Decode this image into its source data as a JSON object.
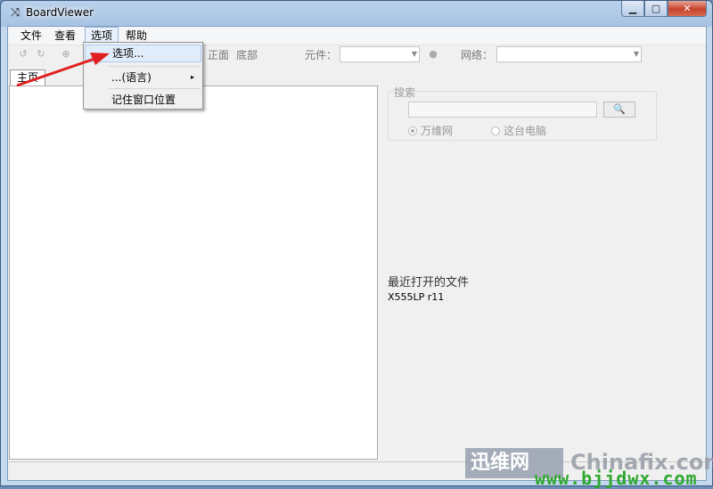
{
  "window": {
    "title": "BoardViewer",
    "app_icon": "⤨",
    "minimize": "▁",
    "maximize": "▢",
    "close": "✕"
  },
  "menu": {
    "file": "文件",
    "view": "查看",
    "options": "选项",
    "help": "帮助"
  },
  "toolbar": {
    "front": "正面",
    "bottom": "底部",
    "component_label": "元件：",
    "net_label": "网络："
  },
  "tabs": {
    "home": "主页"
  },
  "dropdown": {
    "options": "选项...",
    "language": "...(语言)",
    "remember_position": "记住窗口位置",
    "submenu_arrow": "▸"
  },
  "search": {
    "label": "搜索",
    "button_icon": "🔍",
    "option_web": "万维网",
    "option_local": "这台电脑"
  },
  "recent": {
    "title": "最近打开的文件",
    "file": "X555LP r11"
  },
  "watermark": {
    "brand": "迅维网",
    "site": "Chinafix.com",
    "url": "www.bjjdwx.com"
  }
}
